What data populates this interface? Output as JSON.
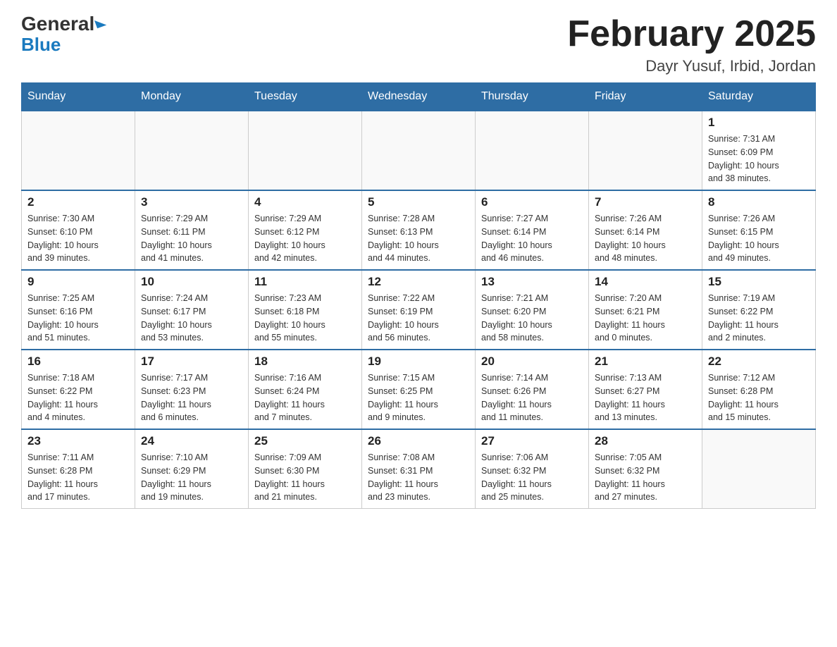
{
  "logo": {
    "general": "General",
    "blue": "Blue"
  },
  "title": "February 2025",
  "subtitle": "Dayr Yusuf, Irbid, Jordan",
  "days_of_week": [
    "Sunday",
    "Monday",
    "Tuesday",
    "Wednesday",
    "Thursday",
    "Friday",
    "Saturday"
  ],
  "weeks": [
    [
      {
        "day": "",
        "info": ""
      },
      {
        "day": "",
        "info": ""
      },
      {
        "day": "",
        "info": ""
      },
      {
        "day": "",
        "info": ""
      },
      {
        "day": "",
        "info": ""
      },
      {
        "day": "",
        "info": ""
      },
      {
        "day": "1",
        "info": "Sunrise: 7:31 AM\nSunset: 6:09 PM\nDaylight: 10 hours\nand 38 minutes."
      }
    ],
    [
      {
        "day": "2",
        "info": "Sunrise: 7:30 AM\nSunset: 6:10 PM\nDaylight: 10 hours\nand 39 minutes."
      },
      {
        "day": "3",
        "info": "Sunrise: 7:29 AM\nSunset: 6:11 PM\nDaylight: 10 hours\nand 41 minutes."
      },
      {
        "day": "4",
        "info": "Sunrise: 7:29 AM\nSunset: 6:12 PM\nDaylight: 10 hours\nand 42 minutes."
      },
      {
        "day": "5",
        "info": "Sunrise: 7:28 AM\nSunset: 6:13 PM\nDaylight: 10 hours\nand 44 minutes."
      },
      {
        "day": "6",
        "info": "Sunrise: 7:27 AM\nSunset: 6:14 PM\nDaylight: 10 hours\nand 46 minutes."
      },
      {
        "day": "7",
        "info": "Sunrise: 7:26 AM\nSunset: 6:14 PM\nDaylight: 10 hours\nand 48 minutes."
      },
      {
        "day": "8",
        "info": "Sunrise: 7:26 AM\nSunset: 6:15 PM\nDaylight: 10 hours\nand 49 minutes."
      }
    ],
    [
      {
        "day": "9",
        "info": "Sunrise: 7:25 AM\nSunset: 6:16 PM\nDaylight: 10 hours\nand 51 minutes."
      },
      {
        "day": "10",
        "info": "Sunrise: 7:24 AM\nSunset: 6:17 PM\nDaylight: 10 hours\nand 53 minutes."
      },
      {
        "day": "11",
        "info": "Sunrise: 7:23 AM\nSunset: 6:18 PM\nDaylight: 10 hours\nand 55 minutes."
      },
      {
        "day": "12",
        "info": "Sunrise: 7:22 AM\nSunset: 6:19 PM\nDaylight: 10 hours\nand 56 minutes."
      },
      {
        "day": "13",
        "info": "Sunrise: 7:21 AM\nSunset: 6:20 PM\nDaylight: 10 hours\nand 58 minutes."
      },
      {
        "day": "14",
        "info": "Sunrise: 7:20 AM\nSunset: 6:21 PM\nDaylight: 11 hours\nand 0 minutes."
      },
      {
        "day": "15",
        "info": "Sunrise: 7:19 AM\nSunset: 6:22 PM\nDaylight: 11 hours\nand 2 minutes."
      }
    ],
    [
      {
        "day": "16",
        "info": "Sunrise: 7:18 AM\nSunset: 6:22 PM\nDaylight: 11 hours\nand 4 minutes."
      },
      {
        "day": "17",
        "info": "Sunrise: 7:17 AM\nSunset: 6:23 PM\nDaylight: 11 hours\nand 6 minutes."
      },
      {
        "day": "18",
        "info": "Sunrise: 7:16 AM\nSunset: 6:24 PM\nDaylight: 11 hours\nand 7 minutes."
      },
      {
        "day": "19",
        "info": "Sunrise: 7:15 AM\nSunset: 6:25 PM\nDaylight: 11 hours\nand 9 minutes."
      },
      {
        "day": "20",
        "info": "Sunrise: 7:14 AM\nSunset: 6:26 PM\nDaylight: 11 hours\nand 11 minutes."
      },
      {
        "day": "21",
        "info": "Sunrise: 7:13 AM\nSunset: 6:27 PM\nDaylight: 11 hours\nand 13 minutes."
      },
      {
        "day": "22",
        "info": "Sunrise: 7:12 AM\nSunset: 6:28 PM\nDaylight: 11 hours\nand 15 minutes."
      }
    ],
    [
      {
        "day": "23",
        "info": "Sunrise: 7:11 AM\nSunset: 6:28 PM\nDaylight: 11 hours\nand 17 minutes."
      },
      {
        "day": "24",
        "info": "Sunrise: 7:10 AM\nSunset: 6:29 PM\nDaylight: 11 hours\nand 19 minutes."
      },
      {
        "day": "25",
        "info": "Sunrise: 7:09 AM\nSunset: 6:30 PM\nDaylight: 11 hours\nand 21 minutes."
      },
      {
        "day": "26",
        "info": "Sunrise: 7:08 AM\nSunset: 6:31 PM\nDaylight: 11 hours\nand 23 minutes."
      },
      {
        "day": "27",
        "info": "Sunrise: 7:06 AM\nSunset: 6:32 PM\nDaylight: 11 hours\nand 25 minutes."
      },
      {
        "day": "28",
        "info": "Sunrise: 7:05 AM\nSunset: 6:32 PM\nDaylight: 11 hours\nand 27 minutes."
      },
      {
        "day": "",
        "info": ""
      }
    ]
  ],
  "accent_color": "#2e6da4"
}
